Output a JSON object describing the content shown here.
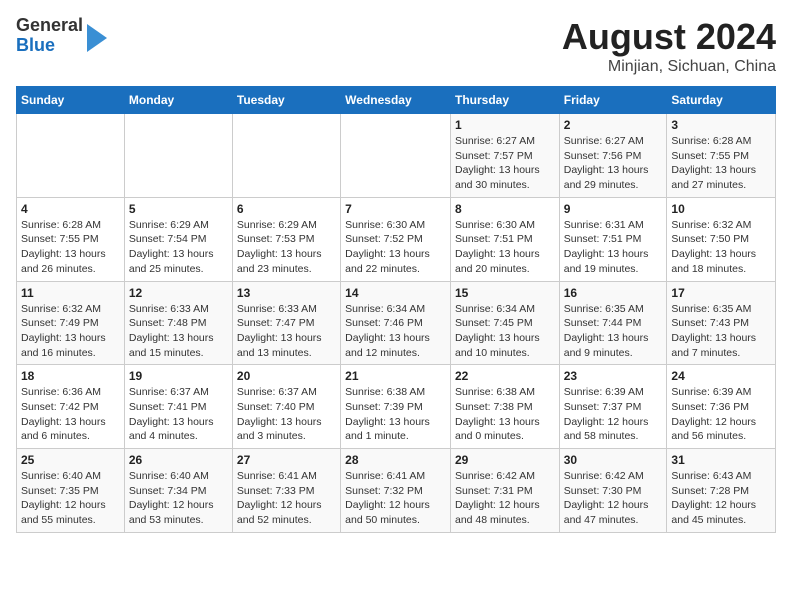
{
  "logo": {
    "general": "General",
    "blue": "Blue"
  },
  "title": "August 2024",
  "subtitle": "Minjian, Sichuan, China",
  "weekdays": [
    "Sunday",
    "Monday",
    "Tuesday",
    "Wednesday",
    "Thursday",
    "Friday",
    "Saturday"
  ],
  "weeks": [
    [
      {
        "day": "",
        "info": ""
      },
      {
        "day": "",
        "info": ""
      },
      {
        "day": "",
        "info": ""
      },
      {
        "day": "",
        "info": ""
      },
      {
        "day": "1",
        "info": "Sunrise: 6:27 AM\nSunset: 7:57 PM\nDaylight: 13 hours and 30 minutes."
      },
      {
        "day": "2",
        "info": "Sunrise: 6:27 AM\nSunset: 7:56 PM\nDaylight: 13 hours and 29 minutes."
      },
      {
        "day": "3",
        "info": "Sunrise: 6:28 AM\nSunset: 7:55 PM\nDaylight: 13 hours and 27 minutes."
      }
    ],
    [
      {
        "day": "4",
        "info": "Sunrise: 6:28 AM\nSunset: 7:55 PM\nDaylight: 13 hours and 26 minutes."
      },
      {
        "day": "5",
        "info": "Sunrise: 6:29 AM\nSunset: 7:54 PM\nDaylight: 13 hours and 25 minutes."
      },
      {
        "day": "6",
        "info": "Sunrise: 6:29 AM\nSunset: 7:53 PM\nDaylight: 13 hours and 23 minutes."
      },
      {
        "day": "7",
        "info": "Sunrise: 6:30 AM\nSunset: 7:52 PM\nDaylight: 13 hours and 22 minutes."
      },
      {
        "day": "8",
        "info": "Sunrise: 6:30 AM\nSunset: 7:51 PM\nDaylight: 13 hours and 20 minutes."
      },
      {
        "day": "9",
        "info": "Sunrise: 6:31 AM\nSunset: 7:51 PM\nDaylight: 13 hours and 19 minutes."
      },
      {
        "day": "10",
        "info": "Sunrise: 6:32 AM\nSunset: 7:50 PM\nDaylight: 13 hours and 18 minutes."
      }
    ],
    [
      {
        "day": "11",
        "info": "Sunrise: 6:32 AM\nSunset: 7:49 PM\nDaylight: 13 hours and 16 minutes."
      },
      {
        "day": "12",
        "info": "Sunrise: 6:33 AM\nSunset: 7:48 PM\nDaylight: 13 hours and 15 minutes."
      },
      {
        "day": "13",
        "info": "Sunrise: 6:33 AM\nSunset: 7:47 PM\nDaylight: 13 hours and 13 minutes."
      },
      {
        "day": "14",
        "info": "Sunrise: 6:34 AM\nSunset: 7:46 PM\nDaylight: 13 hours and 12 minutes."
      },
      {
        "day": "15",
        "info": "Sunrise: 6:34 AM\nSunset: 7:45 PM\nDaylight: 13 hours and 10 minutes."
      },
      {
        "day": "16",
        "info": "Sunrise: 6:35 AM\nSunset: 7:44 PM\nDaylight: 13 hours and 9 minutes."
      },
      {
        "day": "17",
        "info": "Sunrise: 6:35 AM\nSunset: 7:43 PM\nDaylight: 13 hours and 7 minutes."
      }
    ],
    [
      {
        "day": "18",
        "info": "Sunrise: 6:36 AM\nSunset: 7:42 PM\nDaylight: 13 hours and 6 minutes."
      },
      {
        "day": "19",
        "info": "Sunrise: 6:37 AM\nSunset: 7:41 PM\nDaylight: 13 hours and 4 minutes."
      },
      {
        "day": "20",
        "info": "Sunrise: 6:37 AM\nSunset: 7:40 PM\nDaylight: 13 hours and 3 minutes."
      },
      {
        "day": "21",
        "info": "Sunrise: 6:38 AM\nSunset: 7:39 PM\nDaylight: 13 hours and 1 minute."
      },
      {
        "day": "22",
        "info": "Sunrise: 6:38 AM\nSunset: 7:38 PM\nDaylight: 13 hours and 0 minutes."
      },
      {
        "day": "23",
        "info": "Sunrise: 6:39 AM\nSunset: 7:37 PM\nDaylight: 12 hours and 58 minutes."
      },
      {
        "day": "24",
        "info": "Sunrise: 6:39 AM\nSunset: 7:36 PM\nDaylight: 12 hours and 56 minutes."
      }
    ],
    [
      {
        "day": "25",
        "info": "Sunrise: 6:40 AM\nSunset: 7:35 PM\nDaylight: 12 hours and 55 minutes."
      },
      {
        "day": "26",
        "info": "Sunrise: 6:40 AM\nSunset: 7:34 PM\nDaylight: 12 hours and 53 minutes."
      },
      {
        "day": "27",
        "info": "Sunrise: 6:41 AM\nSunset: 7:33 PM\nDaylight: 12 hours and 52 minutes."
      },
      {
        "day": "28",
        "info": "Sunrise: 6:41 AM\nSunset: 7:32 PM\nDaylight: 12 hours and 50 minutes."
      },
      {
        "day": "29",
        "info": "Sunrise: 6:42 AM\nSunset: 7:31 PM\nDaylight: 12 hours and 48 minutes."
      },
      {
        "day": "30",
        "info": "Sunrise: 6:42 AM\nSunset: 7:30 PM\nDaylight: 12 hours and 47 minutes."
      },
      {
        "day": "31",
        "info": "Sunrise: 6:43 AM\nSunset: 7:28 PM\nDaylight: 12 hours and 45 minutes."
      }
    ]
  ]
}
